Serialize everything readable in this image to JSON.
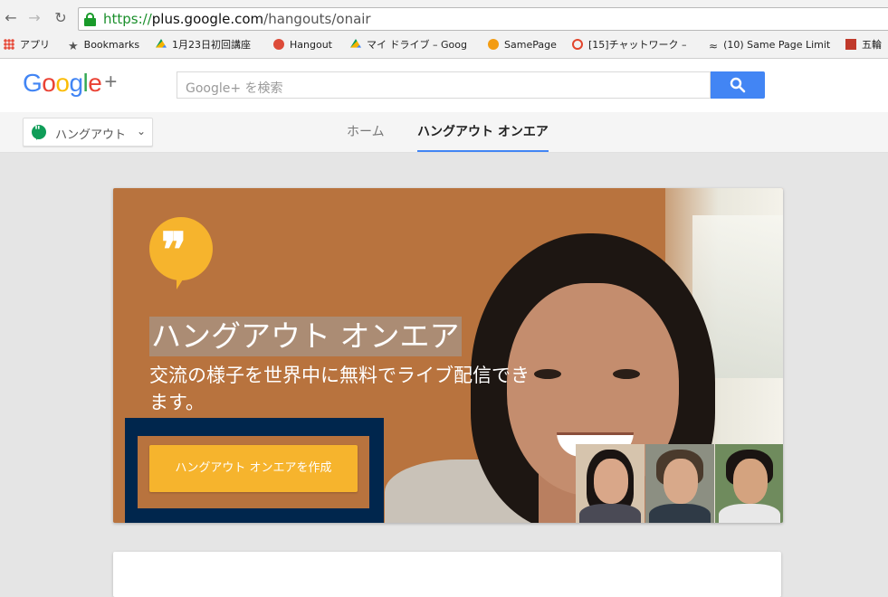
{
  "browser": {
    "url_scheme": "https://",
    "url_host": "plus.google.com",
    "url_path": "/hangouts/onair",
    "bookmarks": [
      {
        "label": "アプリ"
      },
      {
        "label": "Bookmarks"
      },
      {
        "label": "1月23日初回講座"
      },
      {
        "label": "Hangout"
      },
      {
        "label": "マイ ドライブ – Goog"
      },
      {
        "label": "SamePage"
      },
      {
        "label": "[15]チャットワーク –"
      },
      {
        "label": "(10) Same Page Limit"
      },
      {
        "label": "五輪"
      }
    ]
  },
  "header": {
    "logo_letters": [
      "G",
      "o",
      "o",
      "g",
      "l",
      "e",
      "+"
    ],
    "search_placeholder": "Google+ を検索"
  },
  "subnav": {
    "app_name": "ハングアウト",
    "tabs": [
      {
        "label": "ホーム",
        "active": false
      },
      {
        "label": "ハングアウト オンエア",
        "active": true
      }
    ]
  },
  "hero": {
    "title": "ハングアウト オンエア",
    "subtitle": "交流の様子を世界中に無料でライブ配信できます。",
    "cta_label": "ハングアウト オンエアを作成",
    "quote_glyph": "❞"
  },
  "colors": {
    "accent_blue": "#4285f4",
    "hangouts_yellow": "#f6b42d",
    "highlight_frame": "#00264d"
  }
}
